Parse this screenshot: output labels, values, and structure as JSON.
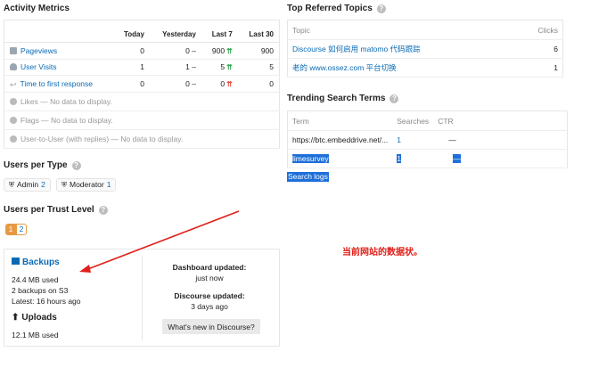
{
  "activity": {
    "title": "Activity Metrics",
    "columns": [
      "",
      "Today",
      "Yesterday",
      "Last 7",
      "Last 30"
    ],
    "rows": [
      {
        "label": "Pageviews",
        "today": "0",
        "yesterday": "0 –",
        "last7": "900",
        "last7_trend": "up",
        "last30": "900"
      },
      {
        "label": "User Visits",
        "today": "1",
        "yesterday": "1 –",
        "last7": "5",
        "last7_trend": "up",
        "last30": "5"
      },
      {
        "label": "Time to first response",
        "today": "0",
        "yesterday": "0 –",
        "last7": "0",
        "last7_trend": "down",
        "last30": "0"
      }
    ],
    "empty_rows": [
      "Likes — No data to display.",
      "Flags — No data to display.",
      "User-to-User (with replies) — No data to display."
    ]
  },
  "users_per_type": {
    "title": "Users per Type",
    "items": [
      {
        "label": "Admin",
        "count": "2"
      },
      {
        "label": "Moderator",
        "count": "1"
      }
    ]
  },
  "trust_level": {
    "title": "Users per Trust Level",
    "levels": [
      "1",
      "2"
    ]
  },
  "backups": {
    "title": "Backups",
    "used": "24.4 MB used",
    "count": "2 backups on S3",
    "latest": "Latest: 16 hours ago",
    "uploads_title": "Uploads",
    "uploads_used": "12.1 MB used",
    "dashboard_label": "Dashboard updated:",
    "dashboard_value": "just now",
    "discourse_label": "Discourse updated:",
    "discourse_value": "3 days ago",
    "whats_new": "What's new in Discourse?"
  },
  "top_referred": {
    "title": "Top Referred Topics",
    "col_topic": "Topic",
    "col_clicks": "Clicks",
    "rows": [
      {
        "topic": "Discourse 如何启用 matomo 代码跟踪",
        "clicks": "6"
      },
      {
        "topic": "老的 www.ossez.com 平台切换",
        "clicks": "1"
      }
    ]
  },
  "trending": {
    "title": "Trending Search Terms",
    "col_term": "Term",
    "col_searches": "Searches",
    "col_ctr": "CTR",
    "rows": [
      {
        "term": "https://btc.embeddrive.net/...",
        "searches": "1",
        "ctr": "—"
      },
      {
        "term": "limesurvey",
        "searches": "1",
        "ctr": "—"
      }
    ],
    "search_logs": "Search logs"
  },
  "annotation": "当前网站的数据状。",
  "colors": {
    "link": "#0a6ab5",
    "arrow": "#e0201a",
    "trust": "#e79a44",
    "selection": "#1e6fd9"
  }
}
